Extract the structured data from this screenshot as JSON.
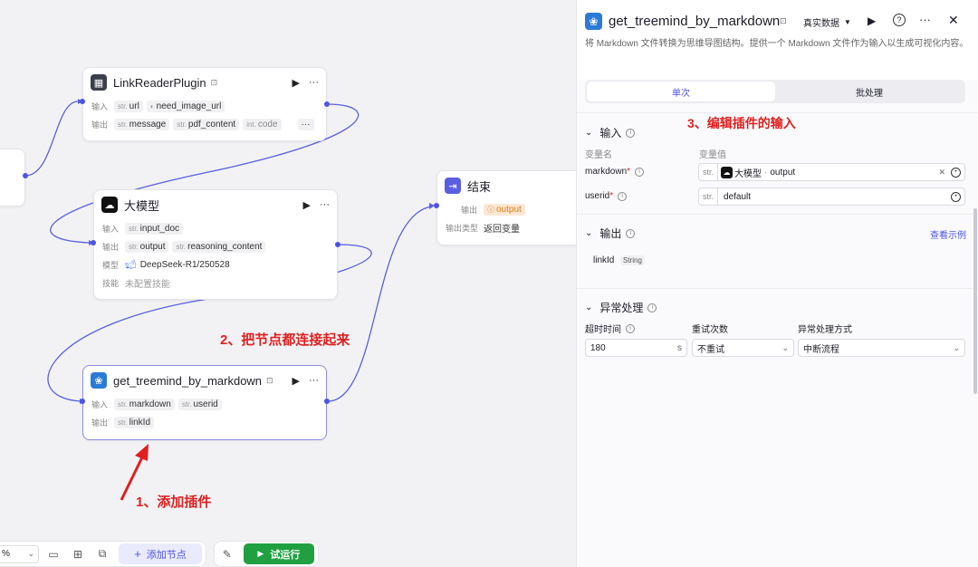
{
  "canvas": {
    "plugin_node": {
      "title": "LinkReaderPlugin",
      "input_label": "输入",
      "output_label": "输出",
      "inputs": [
        "url",
        "need_image_url"
      ],
      "outputs": [
        "message",
        "pdf_content",
        "code"
      ]
    },
    "llm_node": {
      "title": "大模型",
      "input_label": "输入",
      "output_label": "输出",
      "model_label": "模型",
      "skill_label": "技能",
      "inputs": [
        "input_doc"
      ],
      "outputs": [
        "output",
        "reasoning_content"
      ],
      "model": "DeepSeek-R1/250528",
      "skill": "未配置技能"
    },
    "end_node": {
      "title": "结束",
      "output_label": "输出",
      "output_var": "output",
      "output_type_label": "输出类型",
      "output_type": "返回变量"
    },
    "treemind_node": {
      "title": "get_treemind_by_markdown",
      "input_label": "输入",
      "output_label": "输出",
      "inputs": [
        "markdown",
        "userid"
      ],
      "outputs": [
        "linkId"
      ]
    },
    "str_prefix": "str.",
    "int_prefix": "int.",
    "annotations": {
      "step1": "1、添加插件",
      "step2": "2、把节点都连接起来",
      "step3": "3、编辑插件的输入"
    },
    "toolbar": {
      "zoom": "%",
      "add_node": "添加节点",
      "test_run": "试运行"
    }
  },
  "panel": {
    "title": "get_treemind_by_markdown",
    "data_mode": "真实数据",
    "description": "将 Markdown 文件转换为思维导图结构。提供一个 Markdown 文件作为输入以生成可视化内容。",
    "tabs": [
      "单次",
      "批处理"
    ],
    "input_section": {
      "title": "输入",
      "col_name": "变量名",
      "col_value": "变量值",
      "params": [
        {
          "name": "markdown",
          "ref_node": "大模型",
          "ref_var": "output"
        },
        {
          "name": "userid",
          "value": "default"
        }
      ]
    },
    "output_section": {
      "title": "输出",
      "view_example": "查看示例",
      "var_name": "linkId",
      "var_type": "String"
    },
    "exception_section": {
      "title": "异常处理",
      "timeout_label": "超时时间",
      "timeout_value": "180",
      "timeout_unit": "s",
      "retry_label": "重试次数",
      "retry_value": "不重试",
      "method_label": "异常处理方式",
      "method_value": "中断流程"
    }
  },
  "colors": {
    "accent": "#4d53e8",
    "edge": "#5a5fe0",
    "annotation": "#e01f1f",
    "run_button": "#20a040",
    "link": "#4d53e8"
  }
}
